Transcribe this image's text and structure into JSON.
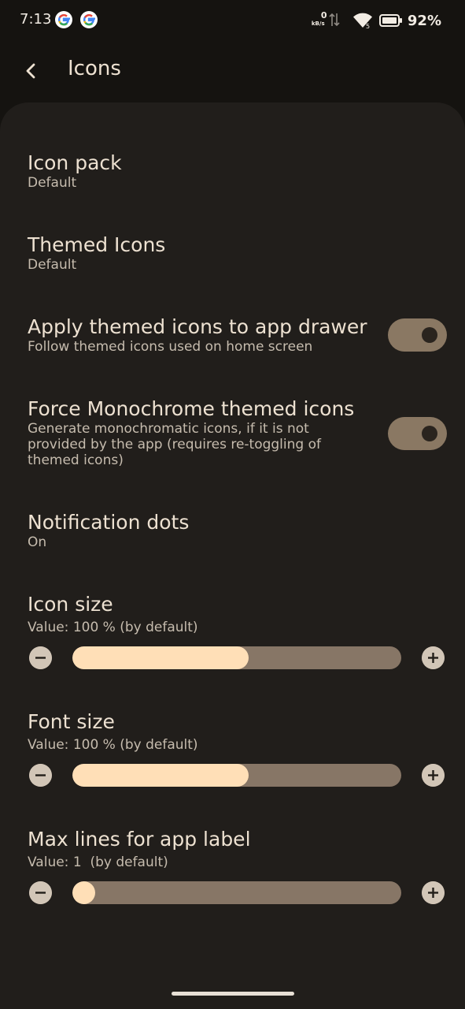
{
  "status": {
    "time": "7:13",
    "net_speed_value": "0",
    "net_speed_unit": "kB/s",
    "battery_percent": "92%"
  },
  "header": {
    "title": "Icons"
  },
  "settings": [
    {
      "title": "Icon pack",
      "summary": "Default"
    },
    {
      "title": "Themed Icons",
      "summary": "Default"
    },
    {
      "title": "Apply themed icons to app drawer",
      "summary": "Follow themed icons used on home screen",
      "toggle": true
    },
    {
      "title": "Force Monochrome themed icons",
      "summary_lines": [
        "Generate monochromatic icons, if it is not",
        "provided by the app (requires re-toggling of",
        "themed icons)"
      ],
      "toggle": true
    },
    {
      "title": "Notification dots",
      "summary": "On"
    }
  ],
  "sliders": [
    {
      "title": "Icon size",
      "value_text": "Value: 100 % (by default)",
      "fraction": 0.535
    },
    {
      "title": "Font size",
      "value_text": "Value: 100 % (by default)",
      "fraction": 0.535
    },
    {
      "title": "Max lines for app label",
      "value_text": "Value: 1  (by default)",
      "fraction": 0.07
    }
  ],
  "icons": {
    "back": "arrow-back-icon",
    "decrease": "minus-icon",
    "increase": "plus-icon"
  },
  "colors": {
    "background": "#151310",
    "sheet": "#211e1b",
    "accent_fill": "#ffdfb7",
    "track": "#877666",
    "switch_track": "#8a7863"
  }
}
